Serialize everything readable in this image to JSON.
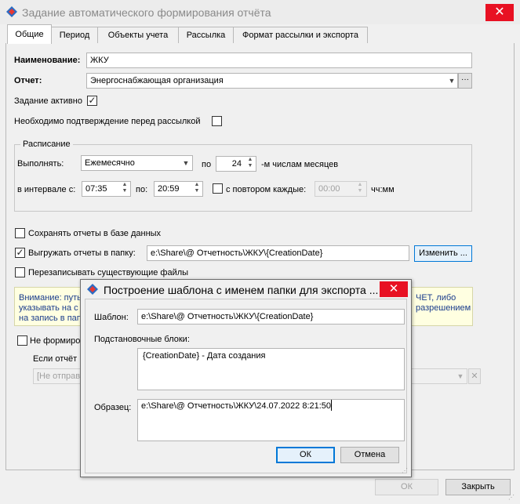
{
  "window": {
    "title": "Задание автоматического формирования отчёта",
    "close": "✕"
  },
  "tabs": [
    "Общие",
    "Период",
    "Объекты учета",
    "Рассылка",
    "Формат рассылки и экспорта"
  ],
  "form": {
    "name_label": "Наименование:",
    "name_value": "ЖКУ",
    "report_label": "Отчет:",
    "report_value": "Энергоснабжающая организация",
    "report_more": "···",
    "active_label": "Задание активно",
    "confirm_label": "Необходимо подтверждение перед рассылкой"
  },
  "schedule": {
    "legend": "Расписание",
    "run_label": "Выполнять:",
    "run_value": "Ежемесячно",
    "on_label": "по",
    "day_value": "24",
    "day_suffix": "-м числам месяцев",
    "interval_label": "в интервале с:",
    "from_value": "07:35",
    "to_label": "по:",
    "to_value": "20:59",
    "repeat_label": "с повтором каждые:",
    "repeat_value": "00:00",
    "repeat_unit": "чч:мм"
  },
  "export": {
    "save_db_label": "Сохранять отчеты в базе данных",
    "export_folder_label": "Выгружать отчеты в папку:",
    "folder_value": "e:\\Share\\@ Отчетность\\ЖКУ\\{CreationDate}",
    "change_button": "Изменить ...",
    "overwrite_label": "Перезаписывать существующие файлы"
  },
  "warning": {
    "line1_left": "Внимание: путь",
    "line1_right": "ЧЕТ, либо",
    "line2_left": "указывать на с",
    "line2_right": "разрешением",
    "line3_left": "на запись в папк"
  },
  "lower": {
    "not_form_label": "Не формиров",
    "if_report_label": "Если отчёт н",
    "dd_value": "[Не отправ",
    "clear_icon": "✕"
  },
  "footer": {
    "ok": "ОК",
    "close": "Закрыть"
  },
  "dialog": {
    "title": "Построение шаблона с именем папки для экспорта ...",
    "close": "✕",
    "template_label": "Шаблон:",
    "template_value": "e:\\Share\\@ Отчетность\\ЖКУ\\{CreationDate}",
    "blocks_label": "Подстановочные блоки:",
    "blocks_item": "{CreationDate} - Дата создания",
    "sample_label": "Образец:",
    "sample_value": "e:\\Share\\@ Отчетность\\ЖКУ\\24.07.2022 8:21:50",
    "ok": "ОК",
    "cancel": "Отмена"
  }
}
